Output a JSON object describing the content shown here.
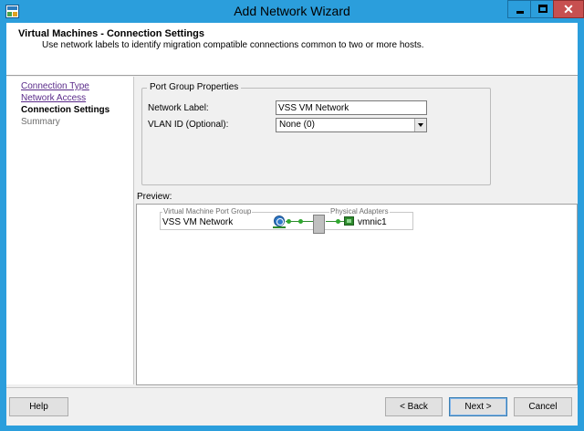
{
  "window": {
    "title": "Add Network Wizard",
    "close_glyph": "✕"
  },
  "header": {
    "title": "Virtual Machines - Connection Settings",
    "subtitle": "Use network labels to identify migration compatible connections common to two or more hosts."
  },
  "steps": [
    {
      "label": "Connection Type",
      "state": "visited"
    },
    {
      "label": "Network Access",
      "state": "visited"
    },
    {
      "label": "Connection Settings",
      "state": "current"
    },
    {
      "label": "Summary",
      "state": "pending"
    }
  ],
  "port_group": {
    "legend": "Port Group Properties",
    "network_label_caption": "Network Label:",
    "network_label_value": "VSS VM Network",
    "vlan_caption": "VLAN ID (Optional):",
    "vlan_value": "None (0)"
  },
  "preview": {
    "label": "Preview:",
    "port_group_header": "Virtual Machine Port Group",
    "adapters_header": "Physical Adapters",
    "port_group_name": "VSS VM Network",
    "adapter_name": "vmnic1"
  },
  "buttons": {
    "help": "Help",
    "back": "< Back",
    "next": "Next >",
    "cancel": "Cancel"
  },
  "colors": {
    "titlebar": "#2b9edc",
    "close_button": "#c75050",
    "link": "#5a2b8a",
    "connection": "#2d8a2d"
  },
  "icons": [
    "app-icon",
    "minimize-icon",
    "maximize-icon",
    "close-icon",
    "vm-network-icon",
    "physical-nic-icon"
  ]
}
